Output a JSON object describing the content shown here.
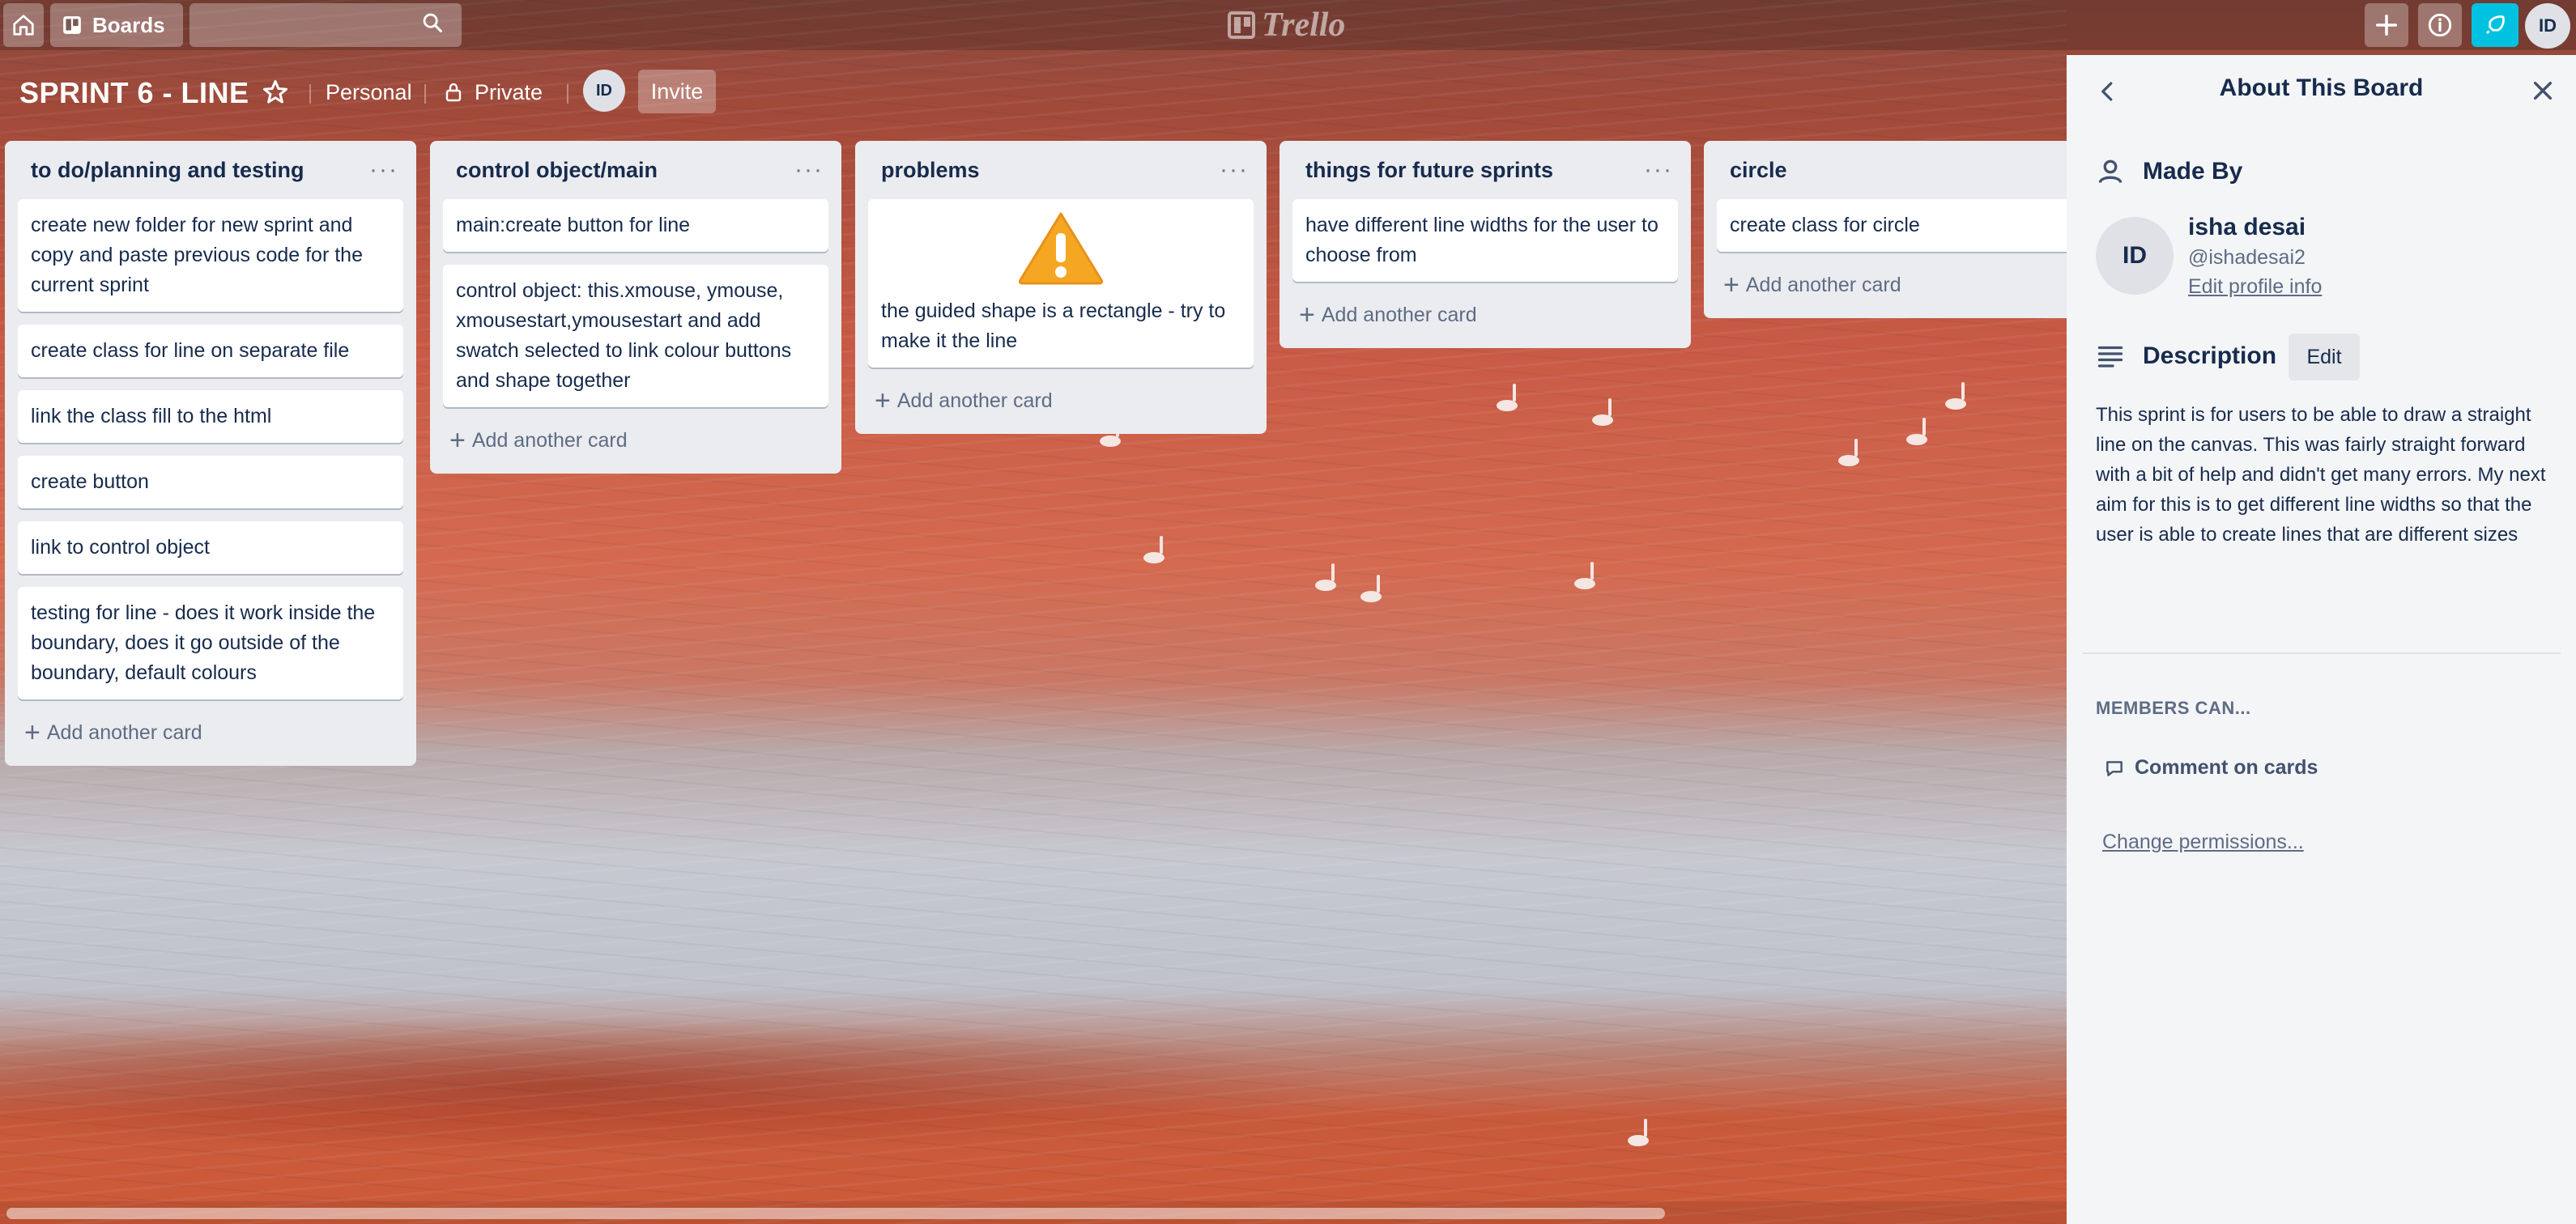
{
  "topbar": {
    "boards_label": "Boards",
    "search_placeholder": "",
    "logo_text": "Trello",
    "user_initials": "ID"
  },
  "board": {
    "title": "SPRINT 6 - LINE",
    "team_label": "Personal",
    "visibility_label": "Private",
    "member_initials": "ID",
    "invite_label": "Invite"
  },
  "lists": [
    {
      "title": "to do/planning and testing",
      "cards": [
        "create new folder for new sprint and copy and paste previous code for the current sprint",
        "create class for line on separate file",
        "link the class fill to the html",
        "create button",
        "link to control object",
        "testing for line - does it work inside the boundary, does it go outside of the boundary, default colours"
      ],
      "add_label": "Add another card"
    },
    {
      "title": "control object/main",
      "cards": [
        "main:create button for line",
        "control object: this.xmouse, ymouse, xmousestart,ymousestart and add swatch selected to link colour buttons and shape together"
      ],
      "add_label": "Add another card"
    },
    {
      "title": "problems",
      "cards": [
        "the guided shape is a rectangle - try to make it the line"
      ],
      "card_icon": "warning-icon",
      "add_label": "Add another card"
    },
    {
      "title": "things for future sprints",
      "cards": [
        "have different line widths for the user to choose from"
      ],
      "add_label": "Add another card"
    },
    {
      "title": "circle",
      "cards": [
        "create class for circle"
      ],
      "add_label": "Add another card"
    }
  ],
  "sidebar": {
    "title": "About This Board",
    "made_by_label": "Made By",
    "creator_initials": "ID",
    "creator_name": "isha desai",
    "creator_handle": "@ishadesai2",
    "edit_profile_label": "Edit profile info",
    "description_label": "Description",
    "description_edit_label": "Edit",
    "description_text": "This sprint is for users to be able to draw a straight line on the canvas. This was fairly straight forward with a bit of help and didn't get many errors. My next aim for this is to get different line widths so that the user is able to create lines that are different sizes",
    "members_can_label": "MEMBERS CAN...",
    "comment_permission": "Comment on cards",
    "change_permissions_label": "Change permissions..."
  },
  "colors": {
    "notification_accent": "#00c2e0",
    "list_bg": "#ebecf0",
    "sidebar_bg": "#f4f5f7",
    "warning": "#f5a623"
  }
}
